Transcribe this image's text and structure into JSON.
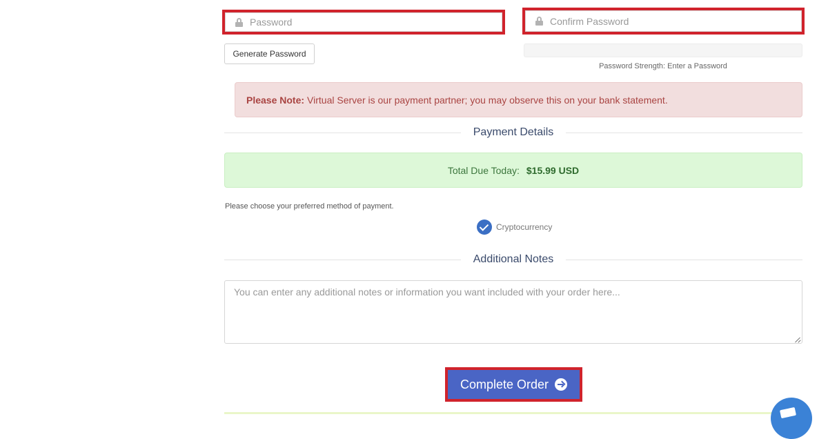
{
  "password": {
    "placeholder": "Password",
    "generate_label": "Generate Password"
  },
  "confirm_password": {
    "placeholder": "Confirm Password",
    "strength_text": "Password Strength: Enter a Password"
  },
  "note": {
    "prefix": "Please Note:",
    "text": "Virtual Server is our payment partner; you may observe this on your bank statement."
  },
  "payment": {
    "section_title": "Payment Details",
    "total_label": "Total Due Today:",
    "total_amount": "$15.99 USD",
    "choose_text": "Please choose your preferred method of payment.",
    "method_label": "Cryptocurrency"
  },
  "notes": {
    "section_title": "Additional Notes",
    "placeholder": "You can enter any additional notes or information you want included with your order here..."
  },
  "complete_order_label": "Complete Order",
  "icons": {
    "lock": "lock-icon",
    "check": "check-circle-icon",
    "arrow": "arrow-right-circle-icon",
    "chat": "chat-icon"
  },
  "colors": {
    "highlight_border": "#d0232c",
    "primary_button": "#4a65c5",
    "alert_bg": "#f2dede",
    "success_bg": "#ddf8d8"
  }
}
